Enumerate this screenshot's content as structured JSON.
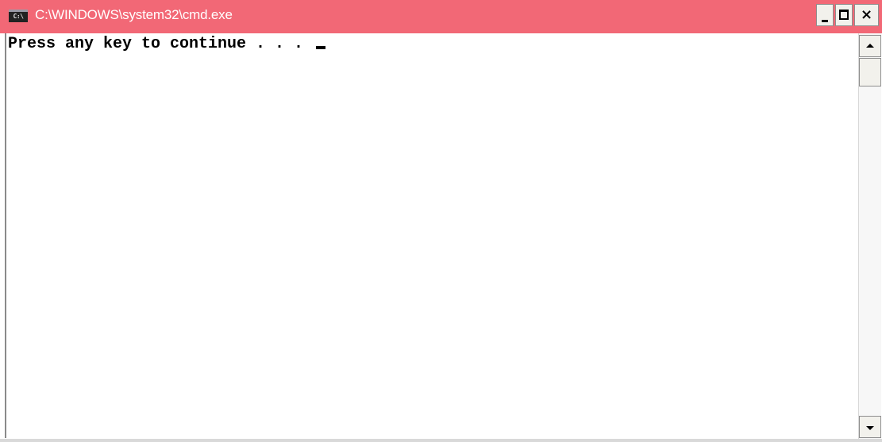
{
  "window": {
    "title": "C:\\WINDOWS\\system32\\cmd.exe",
    "icon_label": "C:\\",
    "icon": "cmd-console-icon",
    "titlebar_color": "#f26876"
  },
  "controls": {
    "minimize_icon": "minimize-icon",
    "maximize_icon": "maximize-icon",
    "close_icon": "close-icon",
    "close_glyph": "×"
  },
  "console": {
    "output_line": "Press any key to continue . . . ",
    "text_color": "#000000",
    "background_color": "#ffffff"
  },
  "scrollbar": {
    "up_icon": "arrow-up-icon",
    "down_icon": "arrow-down-icon"
  }
}
